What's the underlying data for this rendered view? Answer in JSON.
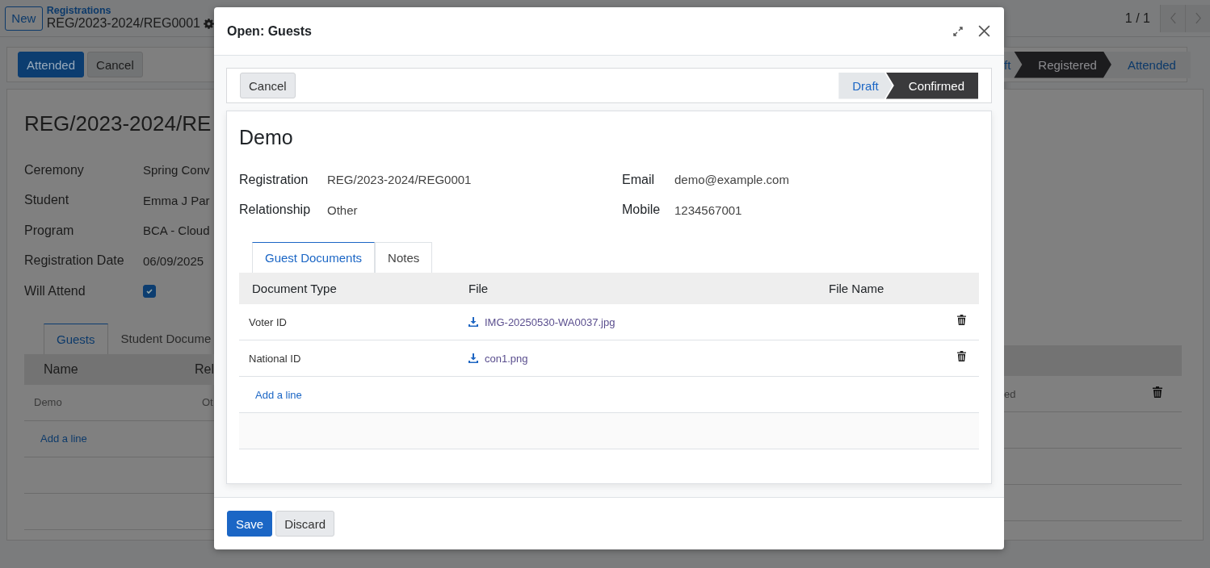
{
  "new_button": "New",
  "breadcrumb": {
    "parent": "Registrations",
    "record": "REG/2023-2024/REG0001"
  },
  "pager": "1 / 1",
  "actions": [
    {
      "label": "Attended",
      "kind": "primary"
    },
    {
      "label": "Cancel",
      "kind": "secondary"
    }
  ],
  "statusbar": [
    {
      "label": "ft",
      "selected": false
    },
    {
      "label": "Registered",
      "selected": true
    },
    {
      "label": "Attended",
      "selected": false
    }
  ],
  "record": {
    "title": "REG/2023-2024/RE",
    "fields": [
      {
        "label": "Ceremony",
        "kind": "text",
        "value": "Spring Conv"
      },
      {
        "label": "Student",
        "kind": "text",
        "value": "Emma J Par"
      },
      {
        "label": "Program",
        "kind": "text",
        "value": "BCA - Cloud"
      },
      {
        "label": "Registration Date",
        "kind": "text",
        "value": "06/09/2025"
      },
      {
        "label": "Will Attend",
        "kind": "checkbox",
        "checked": true
      }
    ]
  },
  "tabs": [
    {
      "label": "Guests",
      "selected": true
    },
    {
      "label": "Student Docume",
      "selected": false
    }
  ],
  "table": {
    "columns": [
      "Name",
      "Rel"
    ],
    "rows": [
      {
        "name": "Demo",
        "relationship": "Ot",
        "status": "ed"
      }
    ],
    "add_line": "Add a line"
  },
  "dialog": {
    "title": "Open: Guests",
    "actions": [
      "Cancel"
    ],
    "statusbar": [
      {
        "label": "Draft",
        "selected": false
      },
      {
        "label": "Confirmed",
        "selected": true
      }
    ],
    "record": {
      "name": "Demo",
      "fields": [
        {
          "label": "Registration",
          "value": "REG/2023-2024/REG0001"
        },
        {
          "label": "Email",
          "value": "demo@example.com"
        },
        {
          "label": "Relationship",
          "value": "Other"
        },
        {
          "label": "Mobile",
          "value": "1234567001"
        }
      ]
    },
    "tabs": [
      {
        "label": "Guest Documents",
        "selected": true
      },
      {
        "label": "Notes",
        "selected": false
      }
    ],
    "table": {
      "columns": [
        "Document Type",
        "File",
        "File Name"
      ],
      "rows": [
        {
          "document_type": "Voter ID",
          "file": "IMG-20250530-WA0037.jpg"
        },
        {
          "document_type": "National ID",
          "file": "con1.png"
        }
      ],
      "add_line": "Add a line"
    },
    "buttons": [
      {
        "label": "Save",
        "kind": "primary"
      },
      {
        "label": "Discard",
        "kind": "secondary"
      }
    ]
  }
}
